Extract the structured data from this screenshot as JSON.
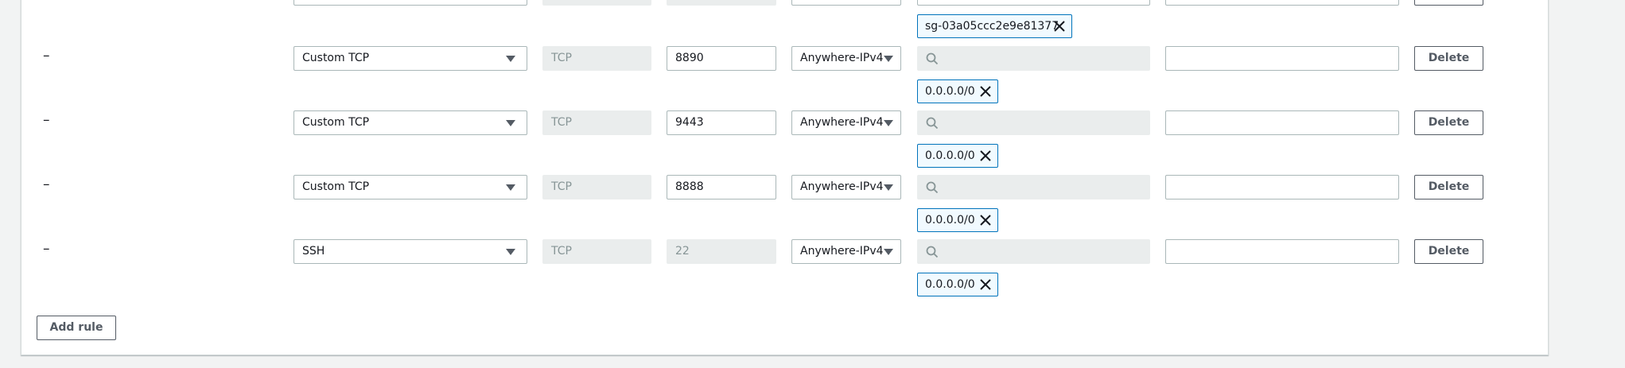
{
  "top_token": {
    "label": "sg-03a05ccc2e9e81377"
  },
  "rules": [
    {
      "dash": "–",
      "type": "Custom TCP",
      "protocol": "TCP",
      "port": "8890",
      "port_editable": true,
      "source": "Anywhere-IPv4",
      "token": "0.0.0.0/0",
      "delete_label": "Delete"
    },
    {
      "dash": "–",
      "type": "Custom TCP",
      "protocol": "TCP",
      "port": "9443",
      "port_editable": true,
      "source": "Anywhere-IPv4",
      "token": "0.0.0.0/0",
      "delete_label": "Delete"
    },
    {
      "dash": "–",
      "type": "Custom TCP",
      "protocol": "TCP",
      "port": "8888",
      "port_editable": true,
      "source": "Anywhere-IPv4",
      "token": "0.0.0.0/0",
      "delete_label": "Delete"
    },
    {
      "dash": "–",
      "type": "SSH",
      "protocol": "TCP",
      "port": "22",
      "port_editable": false,
      "source": "Anywhere-IPv4",
      "token": "0.0.0.0/0",
      "delete_label": "Delete"
    }
  ],
  "add_rule_label": "Add rule",
  "icons": {
    "search": "search-icon",
    "remove": "close-icon",
    "caret": "caret-down-icon"
  },
  "colors": {
    "token_border": "#0073bb",
    "token_bg": "#f1faff",
    "readonly_bg": "#eaeded"
  }
}
